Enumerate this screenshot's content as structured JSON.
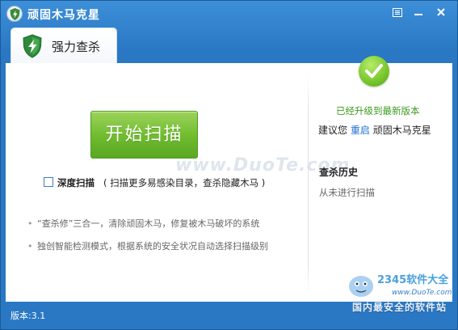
{
  "window": {
    "title": "顽固木马克星"
  },
  "tab": {
    "label": "强力查杀"
  },
  "scan": {
    "button_label": "开始扫描",
    "deep_label": "深度扫描",
    "deep_description": "( 扫描更多易感染目录，查杀隐藏木马 )",
    "deep_checked": false
  },
  "features": [
    "“查杀修”三合一，清除顽固木马，修复被木马破坏的系统",
    "独创智能检测模式，根据系统的安全状况自动选择扫描级别"
  ],
  "status": {
    "upgraded": "已经升级到最新版本",
    "suggest_prefix": "建议您",
    "restart_link": "重启",
    "suggest_suffix": "顽固木马克星"
  },
  "history": {
    "title": "查杀历史",
    "empty": "从未进行扫描"
  },
  "footer": {
    "version": "版本:3.1"
  },
  "watermarks": {
    "duote": "www.DuoTe.com",
    "logo_text": "2345软件大全",
    "logo_url": "www.DuoTe.com",
    "site": "国内最安全的软件站"
  },
  "colors": {
    "title_bar": "#2a78c4",
    "scan_button": "#6fbb2e",
    "success_text": "#3c9a1f",
    "link": "#1f6fd0"
  }
}
